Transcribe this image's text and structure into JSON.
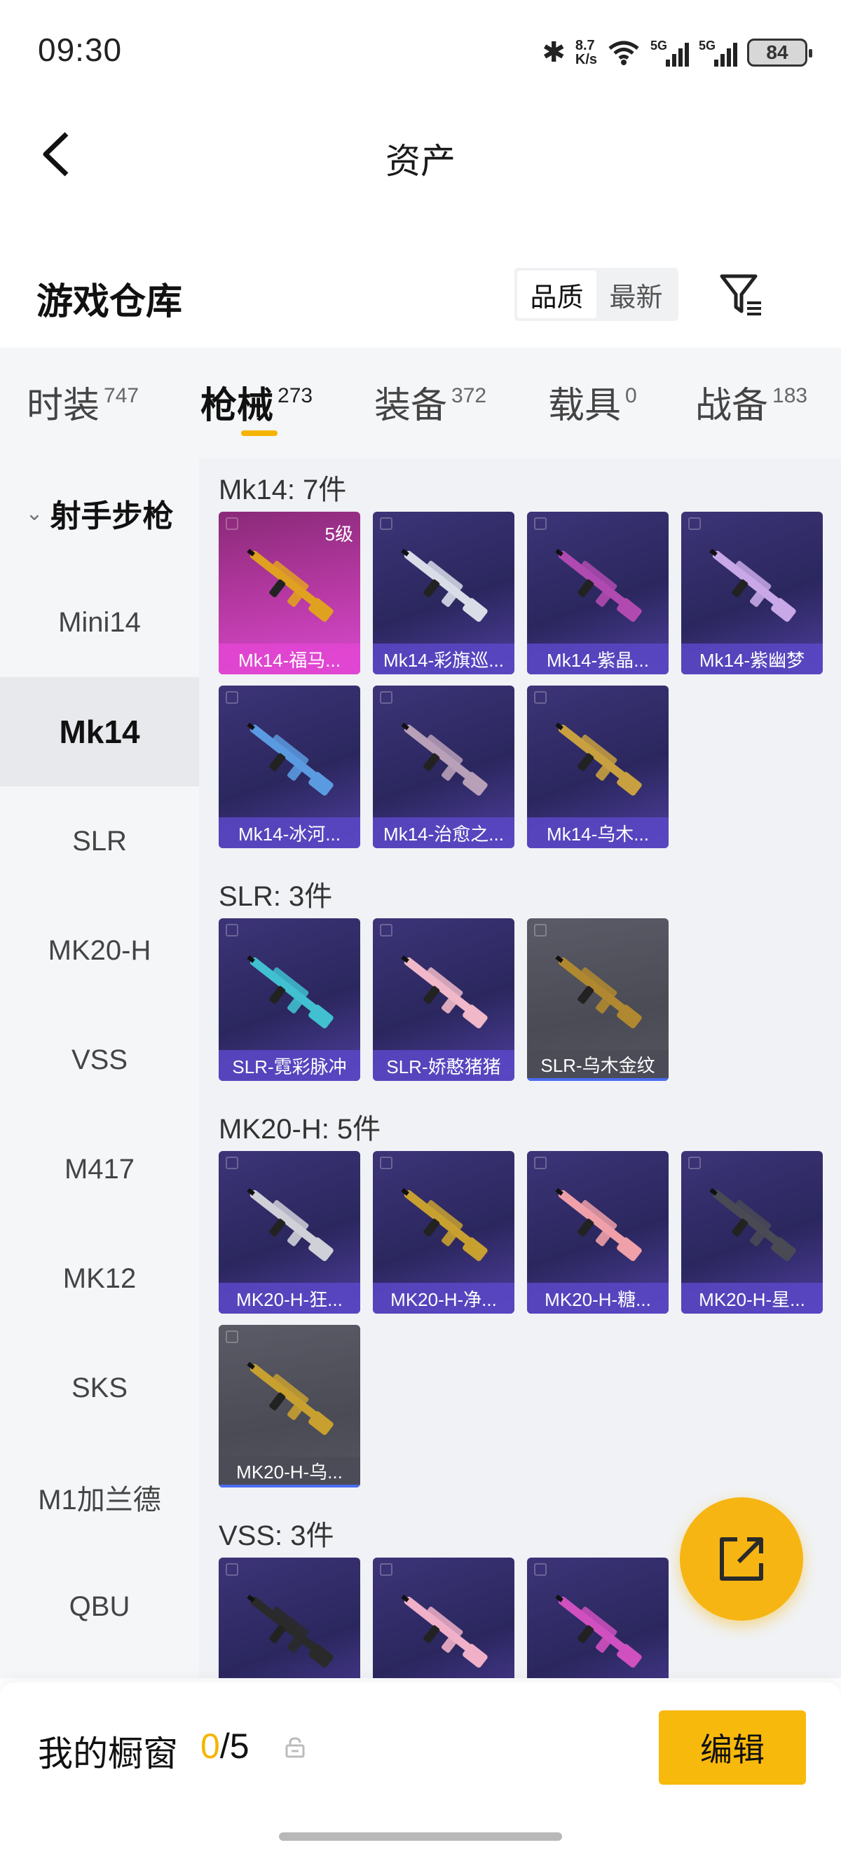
{
  "status_bar": {
    "time": "09:30",
    "net_speed_value": "8.7",
    "net_speed_unit": "K/s",
    "signal1_label": "5G",
    "signal2_label": "5G",
    "battery": "84"
  },
  "header": {
    "title": "资产"
  },
  "warehouse": {
    "title": "游戏仓库",
    "sort_options": [
      "品质",
      "最新"
    ],
    "active_sort": "品质"
  },
  "tabs": [
    {
      "label": "时装",
      "count": "747"
    },
    {
      "label": "枪械",
      "count": "273",
      "active": true
    },
    {
      "label": "装备",
      "count": "372"
    },
    {
      "label": "载具",
      "count": "0"
    },
    {
      "label": "战备",
      "count": "183"
    }
  ],
  "sidebar": {
    "group": "射手步枪",
    "items": [
      "Mini14",
      "Mk14",
      "SLR",
      "MK20-H",
      "VSS",
      "M417",
      "MK12",
      "SKS",
      "M1加兰德",
      "QBU"
    ],
    "active": "Mk14"
  },
  "sections": [
    {
      "title": "Mk14: 7件",
      "items": [
        {
          "name": "Mk14-福马...",
          "level": "5级",
          "rarity": "pink",
          "color": "#e0a020"
        },
        {
          "name": "Mk14-彩旗巡...",
          "rarity": "purple",
          "color": "#d8dde8"
        },
        {
          "name": "Mk14-紫晶...",
          "rarity": "purple",
          "color": "#b04ab0"
        },
        {
          "name": "Mk14-紫幽梦",
          "rarity": "purple",
          "color": "#c9a8e8"
        },
        {
          "name": "Mk14-冰河...",
          "rarity": "purple",
          "color": "#5a9ae0"
        },
        {
          "name": "Mk14-治愈之...",
          "rarity": "purple",
          "color": "#b8a0b8"
        },
        {
          "name": "Mk14-乌木...",
          "rarity": "purple",
          "color": "#c8a040"
        }
      ]
    },
    {
      "title": "SLR: 3件",
      "items": [
        {
          "name": "SLR-霓彩脉冲",
          "rarity": "purple",
          "color": "#40c0d0"
        },
        {
          "name": "SLR-娇憨猪猪",
          "rarity": "purple",
          "color": "#f0b8c8"
        },
        {
          "name": "SLR-乌木金纹",
          "rarity": "gray",
          "color": "#b08830"
        }
      ]
    },
    {
      "title": "MK20-H: 5件",
      "items": [
        {
          "name": "MK20-H-狂...",
          "rarity": "purple",
          "color": "#d0d0d8"
        },
        {
          "name": "MK20-H-净...",
          "rarity": "purple",
          "color": "#c8a030"
        },
        {
          "name": "MK20-H-糖...",
          "rarity": "purple",
          "color": "#f0a0a8"
        },
        {
          "name": "MK20-H-星...",
          "rarity": "purple",
          "color": "#4a4a55"
        },
        {
          "name": "MK20-H-乌...",
          "rarity": "gray",
          "color": "#c8a030"
        }
      ]
    },
    {
      "title": "VSS: 3件",
      "items": [
        {
          "name": "",
          "rarity": "purple",
          "color": "#2a2a2a"
        },
        {
          "name": "",
          "rarity": "purple",
          "color": "#f0b0c8"
        },
        {
          "name": "",
          "rarity": "purple",
          "color": "#d050c0"
        }
      ]
    }
  ],
  "bottom": {
    "showcase_label": "我的橱窗",
    "showcase_current": "0",
    "showcase_total": "/5",
    "edit_label": "编辑"
  },
  "colors": {
    "accent": "#f5b400",
    "edit_button": "#f8b90d",
    "rare_purple": "#5a48c8",
    "rare_pink": "#e146d2"
  }
}
